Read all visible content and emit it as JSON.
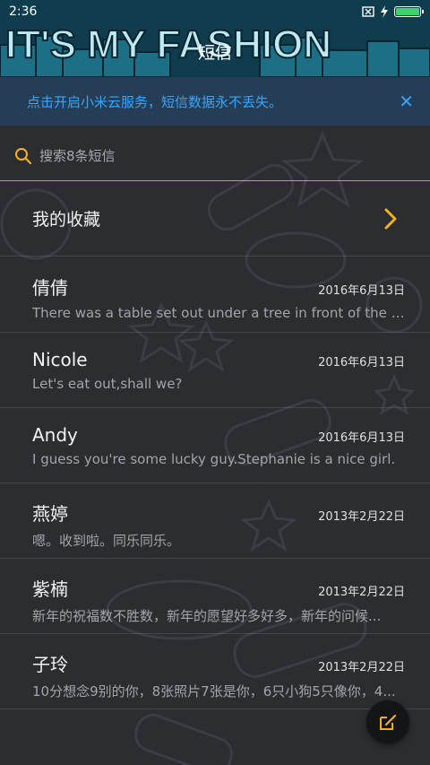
{
  "statusbar": {
    "time": "2:36"
  },
  "header": {
    "title": "短信",
    "banner_art": "IT'S MY FASHION"
  },
  "banner": {
    "text": "点击开启小米云服务，短信数据永不丢失。",
    "close_icon": "close-icon"
  },
  "search": {
    "placeholder": "搜索8条短信"
  },
  "favorites": {
    "label": "我的收藏"
  },
  "conversations": [
    {
      "name": "倩倩",
      "date": "2016年6月13日",
      "preview": "There was a table set out under a tree in front of the ho..."
    },
    {
      "name": "Nicole",
      "date": "2016年6月13日",
      "preview": "Let's eat out,shall we?"
    },
    {
      "name": "Andy",
      "date": "2016年6月13日",
      "preview": "I guess you're some lucky guy.Stephanie is a nice girl."
    },
    {
      "name": "燕婷",
      "date": "2013年2月22日",
      "preview": "嗯。收到啦。同乐同乐。"
    },
    {
      "name": "紫楠",
      "date": "2013年2月22日",
      "preview": "新年的祝福数不胜数，新年的愿望好多好多，新年的问候..."
    },
    {
      "name": "子玲",
      "date": "2013年2月22日",
      "preview": "10分想念9别的你，8张照片7张是你，6只小狗5只像你，4..."
    }
  ],
  "colors": {
    "accent": "#f2b21d",
    "banner_text": "#35a6ff",
    "battery": "#3fd26b"
  }
}
